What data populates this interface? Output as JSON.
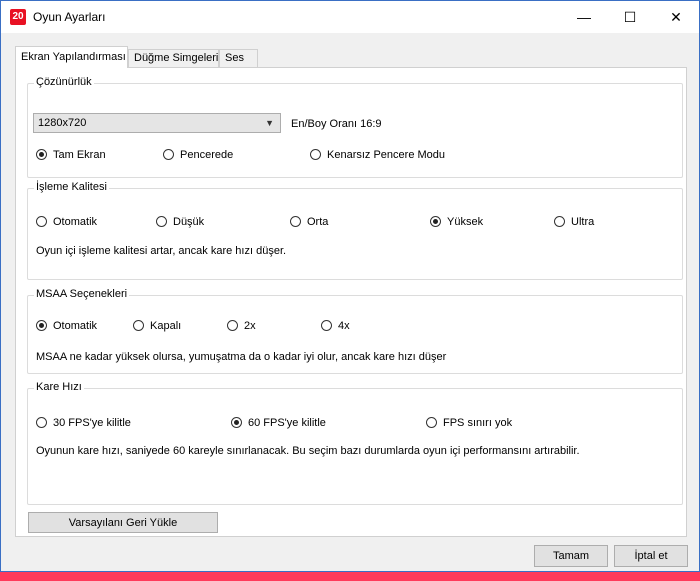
{
  "window": {
    "icon_text": "20",
    "title": "Oyun Ayarları",
    "minimize": "—",
    "maximize": "☐",
    "close": "✕"
  },
  "tabs": [
    "Ekran Yapılandırması",
    "Düğme Simgeleri",
    "Ses"
  ],
  "resolution": {
    "title": "Çözünürlük",
    "selected": "1280x720",
    "aspect_label": "En/Boy Oranı 16:9",
    "modes": [
      "Tam Ekran",
      "Pencerede",
      "Kenarsız Pencere Modu"
    ],
    "selected_mode": 0
  },
  "quality": {
    "title": "İşleme Kalitesi",
    "options": [
      "Otomatik",
      "Düşük",
      "Orta",
      "Yüksek",
      "Ultra"
    ],
    "selected": 3,
    "description": "Oyun içi işleme kalitesi artar, ancak kare hızı düşer."
  },
  "msaa": {
    "title": "MSAA Seçenekleri",
    "options": [
      "Otomatik",
      "Kapalı",
      "2x",
      "4x"
    ],
    "selected": 0,
    "description": "MSAA ne kadar yüksek olursa, yumuşatma da o kadar iyi olur, ancak kare hızı düşer"
  },
  "framerate": {
    "title": "Kare Hızı",
    "options": [
      "30 FPS'ye kilitle",
      "60 FPS'ye kilitle",
      "FPS sınırı yok"
    ],
    "selected": 1,
    "description": "Oyunun kare hızı, saniyede 60 kareyle sınırlanacak. Bu seçim bazı durumlarda oyun içi performansını artırabilir."
  },
  "buttons": {
    "reset": "Varsayılanı Geri Yükle",
    "ok": "Tamam",
    "cancel": "İptal et"
  }
}
